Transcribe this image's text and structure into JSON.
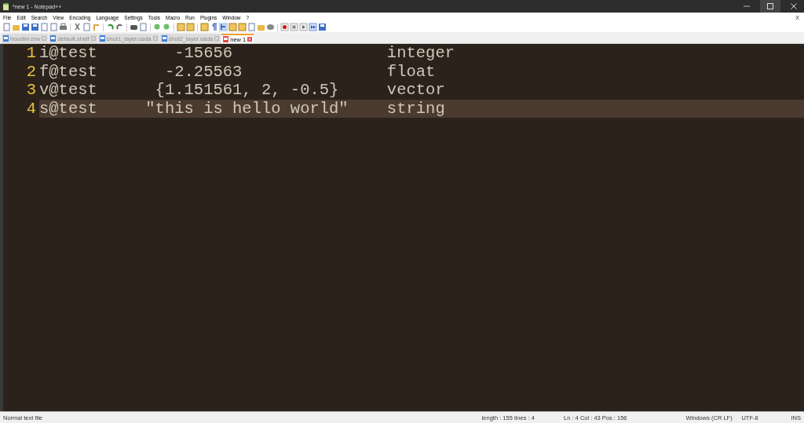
{
  "window": {
    "title": "*new 1 - Notepad++"
  },
  "menu": [
    "File",
    "Edit",
    "Search",
    "View",
    "Encoding",
    "Language",
    "Settings",
    "Tools",
    "Macro",
    "Run",
    "Plugins",
    "Window",
    "?"
  ],
  "menu_close": "X",
  "tabs": [
    {
      "label": "houdini.env",
      "selected": false
    },
    {
      "label": "default.shelf",
      "selected": false
    },
    {
      "label": "shot1_layer.usda",
      "selected": false
    },
    {
      "label": "shot2_layer.usda",
      "selected": false
    },
    {
      "label": "new 1",
      "selected": true
    }
  ],
  "editor": {
    "lines": [
      {
        "number": "1",
        "text": "i@test        -15656                integer",
        "current": false
      },
      {
        "number": "2",
        "text": "f@test       -2.25563               float",
        "current": false
      },
      {
        "number": "3",
        "text": "v@test      {1.151561, 2, -0.5}     vector",
        "current": false
      },
      {
        "number": "4",
        "text": "s@test     \"this is hello world\"    string",
        "current": true
      }
    ]
  },
  "status_bar": {
    "file_type": "Normal text file",
    "length": "length : 155    lines : 4",
    "position": "Ln : 4    Col : 43    Pos : 156",
    "eol": "Windows (CR LF)",
    "encoding": "UTF-8",
    "mode": "INS"
  }
}
